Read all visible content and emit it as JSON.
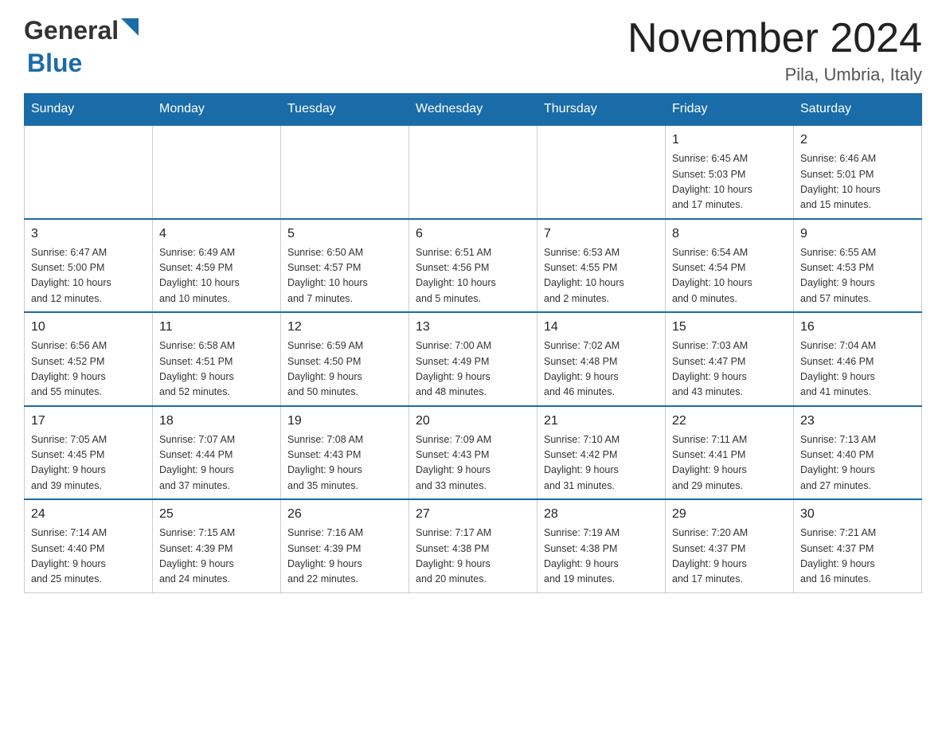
{
  "header": {
    "logo_general": "General",
    "logo_blue": "Blue",
    "month_title": "November 2024",
    "location": "Pila, Umbria, Italy"
  },
  "weekdays": [
    "Sunday",
    "Monday",
    "Tuesday",
    "Wednesday",
    "Thursday",
    "Friday",
    "Saturday"
  ],
  "weeks": [
    [
      {
        "day": "",
        "info": ""
      },
      {
        "day": "",
        "info": ""
      },
      {
        "day": "",
        "info": ""
      },
      {
        "day": "",
        "info": ""
      },
      {
        "day": "",
        "info": ""
      },
      {
        "day": "1",
        "info": "Sunrise: 6:45 AM\nSunset: 5:03 PM\nDaylight: 10 hours\nand 17 minutes."
      },
      {
        "day": "2",
        "info": "Sunrise: 6:46 AM\nSunset: 5:01 PM\nDaylight: 10 hours\nand 15 minutes."
      }
    ],
    [
      {
        "day": "3",
        "info": "Sunrise: 6:47 AM\nSunset: 5:00 PM\nDaylight: 10 hours\nand 12 minutes."
      },
      {
        "day": "4",
        "info": "Sunrise: 6:49 AM\nSunset: 4:59 PM\nDaylight: 10 hours\nand 10 minutes."
      },
      {
        "day": "5",
        "info": "Sunrise: 6:50 AM\nSunset: 4:57 PM\nDaylight: 10 hours\nand 7 minutes."
      },
      {
        "day": "6",
        "info": "Sunrise: 6:51 AM\nSunset: 4:56 PM\nDaylight: 10 hours\nand 5 minutes."
      },
      {
        "day": "7",
        "info": "Sunrise: 6:53 AM\nSunset: 4:55 PM\nDaylight: 10 hours\nand 2 minutes."
      },
      {
        "day": "8",
        "info": "Sunrise: 6:54 AM\nSunset: 4:54 PM\nDaylight: 10 hours\nand 0 minutes."
      },
      {
        "day": "9",
        "info": "Sunrise: 6:55 AM\nSunset: 4:53 PM\nDaylight: 9 hours\nand 57 minutes."
      }
    ],
    [
      {
        "day": "10",
        "info": "Sunrise: 6:56 AM\nSunset: 4:52 PM\nDaylight: 9 hours\nand 55 minutes."
      },
      {
        "day": "11",
        "info": "Sunrise: 6:58 AM\nSunset: 4:51 PM\nDaylight: 9 hours\nand 52 minutes."
      },
      {
        "day": "12",
        "info": "Sunrise: 6:59 AM\nSunset: 4:50 PM\nDaylight: 9 hours\nand 50 minutes."
      },
      {
        "day": "13",
        "info": "Sunrise: 7:00 AM\nSunset: 4:49 PM\nDaylight: 9 hours\nand 48 minutes."
      },
      {
        "day": "14",
        "info": "Sunrise: 7:02 AM\nSunset: 4:48 PM\nDaylight: 9 hours\nand 46 minutes."
      },
      {
        "day": "15",
        "info": "Sunrise: 7:03 AM\nSunset: 4:47 PM\nDaylight: 9 hours\nand 43 minutes."
      },
      {
        "day": "16",
        "info": "Sunrise: 7:04 AM\nSunset: 4:46 PM\nDaylight: 9 hours\nand 41 minutes."
      }
    ],
    [
      {
        "day": "17",
        "info": "Sunrise: 7:05 AM\nSunset: 4:45 PM\nDaylight: 9 hours\nand 39 minutes."
      },
      {
        "day": "18",
        "info": "Sunrise: 7:07 AM\nSunset: 4:44 PM\nDaylight: 9 hours\nand 37 minutes."
      },
      {
        "day": "19",
        "info": "Sunrise: 7:08 AM\nSunset: 4:43 PM\nDaylight: 9 hours\nand 35 minutes."
      },
      {
        "day": "20",
        "info": "Sunrise: 7:09 AM\nSunset: 4:43 PM\nDaylight: 9 hours\nand 33 minutes."
      },
      {
        "day": "21",
        "info": "Sunrise: 7:10 AM\nSunset: 4:42 PM\nDaylight: 9 hours\nand 31 minutes."
      },
      {
        "day": "22",
        "info": "Sunrise: 7:11 AM\nSunset: 4:41 PM\nDaylight: 9 hours\nand 29 minutes."
      },
      {
        "day": "23",
        "info": "Sunrise: 7:13 AM\nSunset: 4:40 PM\nDaylight: 9 hours\nand 27 minutes."
      }
    ],
    [
      {
        "day": "24",
        "info": "Sunrise: 7:14 AM\nSunset: 4:40 PM\nDaylight: 9 hours\nand 25 minutes."
      },
      {
        "day": "25",
        "info": "Sunrise: 7:15 AM\nSunset: 4:39 PM\nDaylight: 9 hours\nand 24 minutes."
      },
      {
        "day": "26",
        "info": "Sunrise: 7:16 AM\nSunset: 4:39 PM\nDaylight: 9 hours\nand 22 minutes."
      },
      {
        "day": "27",
        "info": "Sunrise: 7:17 AM\nSunset: 4:38 PM\nDaylight: 9 hours\nand 20 minutes."
      },
      {
        "day": "28",
        "info": "Sunrise: 7:19 AM\nSunset: 4:38 PM\nDaylight: 9 hours\nand 19 minutes."
      },
      {
        "day": "29",
        "info": "Sunrise: 7:20 AM\nSunset: 4:37 PM\nDaylight: 9 hours\nand 17 minutes."
      },
      {
        "day": "30",
        "info": "Sunrise: 7:21 AM\nSunset: 4:37 PM\nDaylight: 9 hours\nand 16 minutes."
      }
    ]
  ]
}
